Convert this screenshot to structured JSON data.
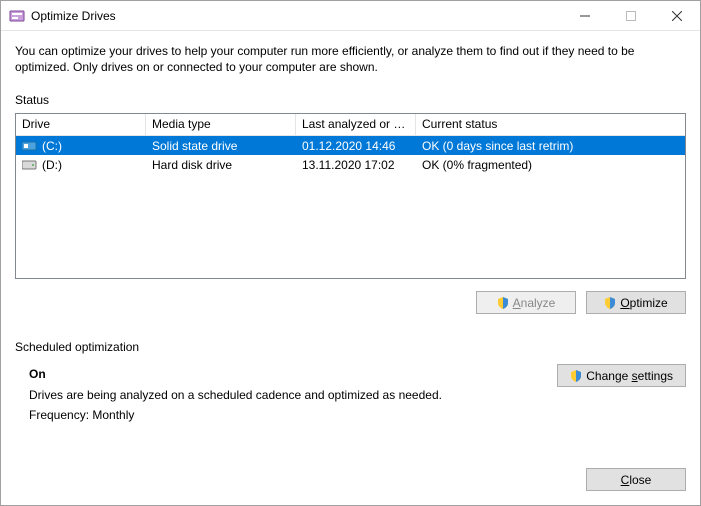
{
  "window": {
    "title": "Optimize Drives"
  },
  "description": "You can optimize your drives to help your computer run more efficiently, or analyze them to find out if they need to be optimized. Only drives on or connected to your computer are shown.",
  "status_label": "Status",
  "columns": {
    "drive": "Drive",
    "media": "Media type",
    "last": "Last analyzed or o...",
    "current": "Current status"
  },
  "drives": [
    {
      "name": "(C:)",
      "media": "Solid state drive",
      "last": "01.12.2020 14:46",
      "status": "OK (0 days since last retrim)",
      "selected": true,
      "icon": "ssd"
    },
    {
      "name": "(D:)",
      "media": "Hard disk drive",
      "last": "13.11.2020 17:02",
      "status": "OK (0% fragmented)",
      "selected": false,
      "icon": "hdd"
    }
  ],
  "buttons": {
    "analyze": "Analyze",
    "optimize": "Optimize",
    "change_settings": "Change settings",
    "close": "Close"
  },
  "scheduled": {
    "section_label": "Scheduled optimization",
    "state": "On",
    "desc": "Drives are being analyzed on a scheduled cadence and optimized as needed.",
    "frequency_label": "Frequency: Monthly"
  }
}
